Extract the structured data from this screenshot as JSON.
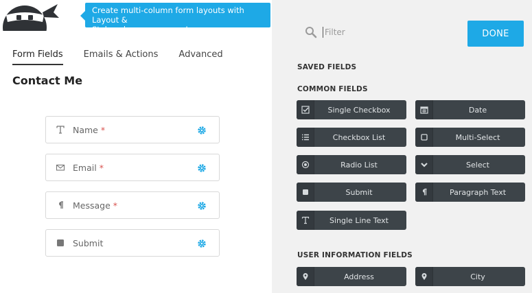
{
  "banner": {
    "line1": "Create multi-column form layouts with Layout &",
    "line2": "Styles...learn more now!"
  },
  "tabs": [
    {
      "label": "Form Fields",
      "active": true
    },
    {
      "label": "Emails & Actions",
      "active": false
    },
    {
      "label": "Advanced",
      "active": false
    }
  ],
  "form": {
    "title": "Contact Me",
    "fields": [
      {
        "label": "Name",
        "required": "*",
        "icon": "text-icon"
      },
      {
        "label": "Email",
        "required": "*",
        "icon": "envelope-icon"
      },
      {
        "label": "Message",
        "required": "*",
        "icon": "paragraph-icon"
      },
      {
        "label": "Submit",
        "required": "",
        "icon": "square-icon"
      }
    ]
  },
  "sidebar": {
    "filter_placeholder": "Filter",
    "done_label": "DONE",
    "saved_fields_heading": "SAVED FIELDS",
    "common_fields_heading": "COMMON FIELDS",
    "user_info_heading": "USER INFORMATION FIELDS",
    "common_fields": [
      {
        "label": "Single Checkbox",
        "icon": "checkbox-icon"
      },
      {
        "label": "Date",
        "icon": "calendar-icon"
      },
      {
        "label": "Checkbox List",
        "icon": "list-icon"
      },
      {
        "label": "Multi-Select",
        "icon": "square-outline-icon"
      },
      {
        "label": "Radio List",
        "icon": "radio-icon"
      },
      {
        "label": "Select",
        "icon": "chevron-down-icon"
      },
      {
        "label": "Submit",
        "icon": "square-icon"
      },
      {
        "label": "Paragraph Text",
        "icon": "paragraph-icon"
      },
      {
        "label": "Single Line Text",
        "icon": "text-icon"
      }
    ],
    "user_fields": [
      {
        "label": "Address",
        "icon": "map-marker-icon"
      },
      {
        "label": "City",
        "icon": "map-marker-icon"
      }
    ]
  },
  "colors": {
    "accent": "#1ea9e6",
    "button_bg": "#3d4449",
    "required": "#d9534f",
    "sidebar_bg": "#f1f1f1"
  }
}
